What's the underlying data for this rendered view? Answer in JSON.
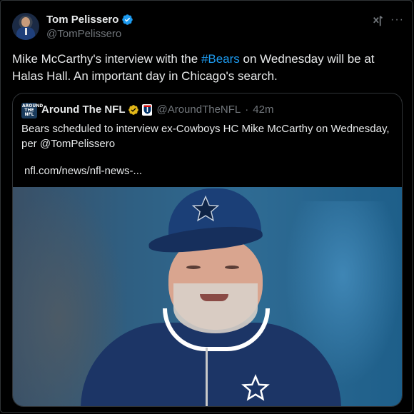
{
  "post": {
    "author_name": "Tom Pelissero",
    "author_handle": "@TomPelissero",
    "text_before": "Mike McCarthy's interview with the ",
    "hashtag": "#Bears",
    "text_after": " on Wednesday will be at Halas Hall. An important day in Chicago's search.",
    "more_label": "···",
    "colors": {
      "accent": "#1d9bf0",
      "muted": "#71767b",
      "background": "#000000"
    }
  },
  "quote": {
    "author_name": "Around The NFL",
    "author_handle": "@AroundTheNFL",
    "separator": "·",
    "time": "42m",
    "text": "Bears scheduled to interview ex-Cowboys HC Mike McCarthy on Wednesday, per @TomPelissero",
    "link": "nfl.com/news/nfl-news-...",
    "avatar_text": "AROUND THE NFL"
  },
  "icons": {
    "verified": "verified-badge-icon",
    "grok": "grok-icon",
    "more": "more-options-icon",
    "gold_badge": "gold-verified-icon",
    "org_badge": "nfl-shield-icon"
  }
}
